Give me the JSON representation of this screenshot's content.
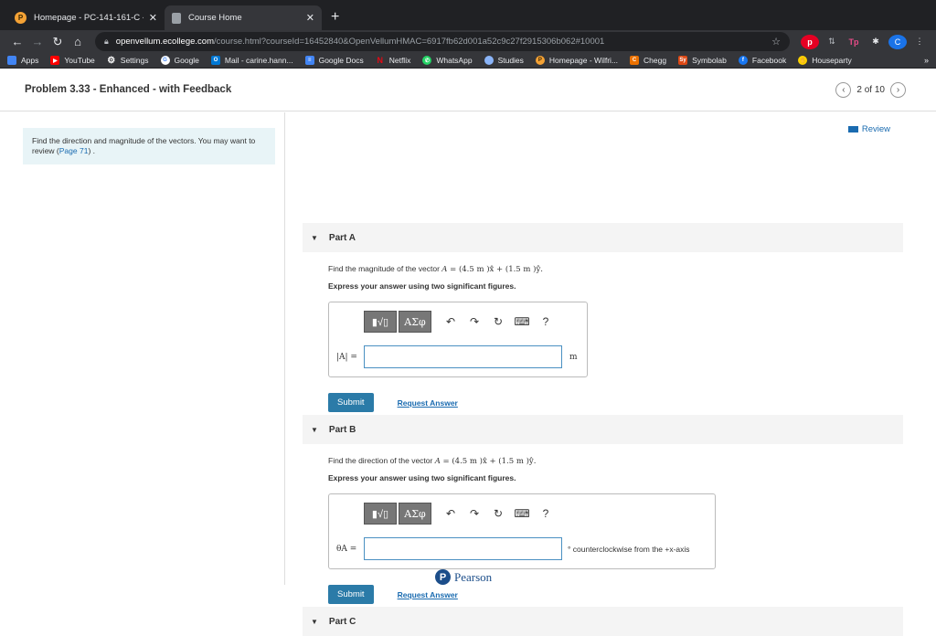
{
  "browser": {
    "tabs": [
      {
        "title": "Homepage - PC-141-161-C - M",
        "active": false
      },
      {
        "title": "Course Home",
        "active": true
      }
    ],
    "url_host": "openvellum.ecollege.com",
    "url_path": "/course.html?courseId=16452840&OpenVellumHMAC=6917fb62d001a52c9c27f2915306b062#10001",
    "bookmarks": [
      "Apps",
      "YouTube",
      "Settings",
      "Google",
      "Mail - carine.hann...",
      "Google Docs",
      "Netflix",
      "WhatsApp",
      "Studies",
      "Homepage - Wilfri...",
      "Chegg",
      "Symbolab",
      "Facebook",
      "Houseparty"
    ],
    "bookmarks_more": "»",
    "profile_initial": "C"
  },
  "problem": {
    "title": "Problem 3.33 - Enhanced - with Feedback",
    "pager": "2 of 10",
    "review_label": "Review",
    "intro_text": "Find the direction and magnitude of the vectors. You may want to review (",
    "intro_link": "Page 71",
    "intro_end": ") ."
  },
  "parts": [
    {
      "label": "Part A",
      "question_pre": "Find the magnitude of the vector ",
      "vector": "A",
      "question_expr": " = (4.5 m )x̂ + (1.5 m )ŷ.",
      "instruction": "Express your answer using two significant figures.",
      "answer_label": "|A| =",
      "unit": "m",
      "submit": "Submit",
      "request": "Request Answer"
    },
    {
      "label": "Part B",
      "question_pre": "Find the direction of the vector ",
      "vector": "A",
      "question_expr": " = (4.5 m )x̂ + (1.5 m )ŷ.",
      "instruction": "Express your answer using two significant figures.",
      "answer_label": "θA =",
      "unit": "° counterclockwise from the +x-axis",
      "submit": "Submit",
      "request": "Request Answer"
    },
    {
      "label": "Part C"
    }
  ],
  "toolbar": {
    "templates": "▮√▯",
    "greek": "ΑΣφ",
    "undo": "↶",
    "redo": "↷",
    "reset": "↻",
    "keyboard": "⌨",
    "help": "?"
  },
  "footer": {
    "brand": "Pearson",
    "logo_letter": "P"
  }
}
